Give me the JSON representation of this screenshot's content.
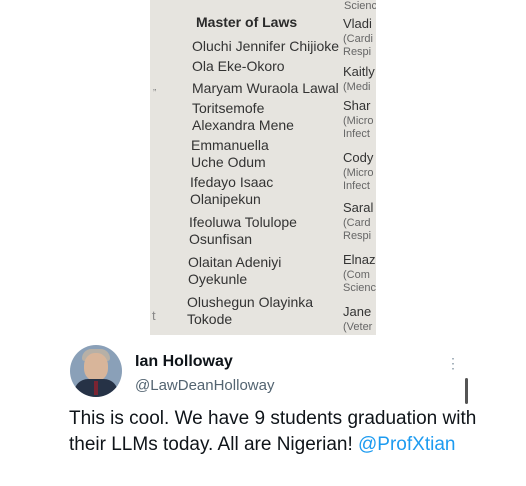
{
  "photo": {
    "heading": "Master of Laws",
    "names": [
      [
        "Oluchi Jennifer Chijioke"
      ],
      [
        "Ola Eke-Okoro"
      ],
      [
        "Maryam Wuraola Lawal"
      ],
      [
        "Toritsemofe",
        "Alexandra Mene"
      ],
      [
        "Emmanuella",
        "Uche Odum"
      ],
      [
        "Ifedayo Isaac",
        "Olanipekun"
      ],
      [
        "Ifeoluwa Tolulope",
        "Osunfisan"
      ],
      [
        "Olaitan Adeniyi",
        "Oyekunle"
      ],
      [
        "Olushegun Olayinka",
        "Tokode"
      ]
    ],
    "right_col": {
      "top": "Scienc",
      "entries": [
        {
          "name": "Vladi",
          "detail": [
            "(Cardi",
            "Respi"
          ]
        },
        {
          "name": "Kaitly",
          "detail": [
            "(Medi"
          ]
        },
        {
          "name": "Shar",
          "detail": [
            "(Micro",
            "Infect"
          ]
        },
        {
          "name": "Cody",
          "detail": [
            "(Micro",
            "Infect"
          ]
        },
        {
          "name": "Saral",
          "detail": [
            "(Card",
            "Respi"
          ]
        },
        {
          "name": "Elnaz",
          "detail": [
            "(Com",
            "Scienc"
          ]
        },
        {
          "name": "Jane",
          "detail": [
            "(Veter"
          ]
        }
      ]
    },
    "margin_marks": [
      "”",
      "t"
    ]
  },
  "tweet": {
    "display_name": "Ian Holloway",
    "handle": "@LawDeanHolloway",
    "text": "This is cool. We have 9 students graduation with their LLMs today. All are Nigerian!",
    "mention": "@ProfXtian",
    "more": "⋮"
  }
}
